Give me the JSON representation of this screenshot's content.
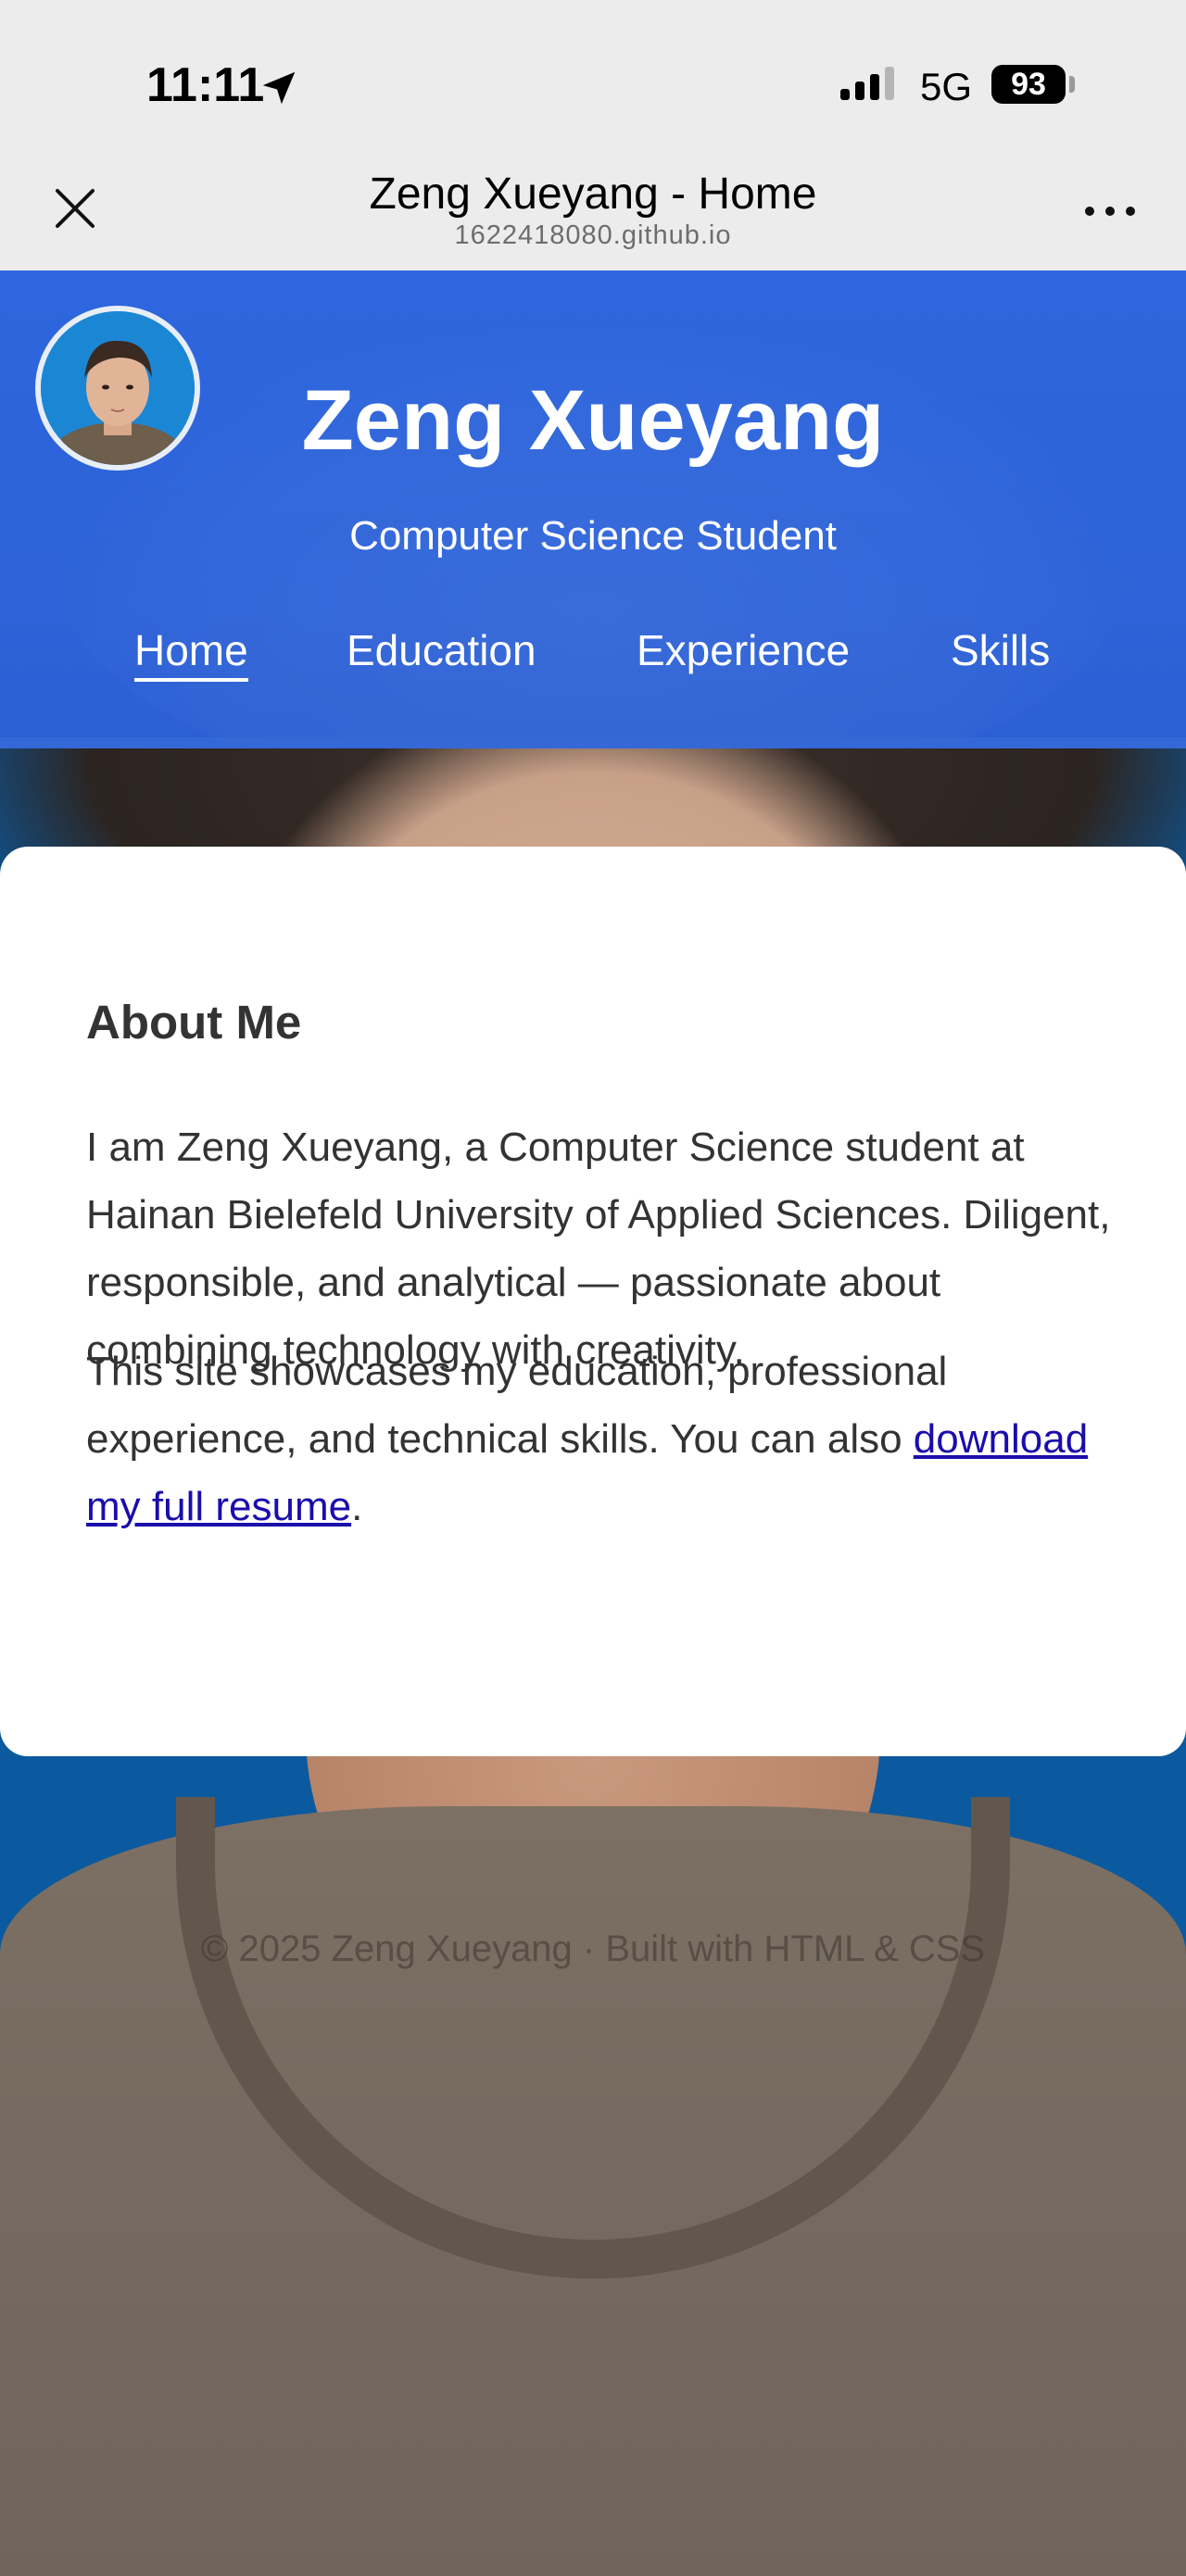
{
  "status_bar": {
    "time": "11:11",
    "network": "5G",
    "battery": "93"
  },
  "browser": {
    "title": "Zeng Xueyang - Home",
    "url": "1622418080.github.io"
  },
  "site": {
    "name": "Zeng Xueyang",
    "subtitle": "Computer Science Student",
    "nav": [
      {
        "label": "Home",
        "active": true
      },
      {
        "label": "Education",
        "active": false
      },
      {
        "label": "Experience",
        "active": false
      },
      {
        "label": "Skills",
        "active": false
      }
    ]
  },
  "about": {
    "heading": "About Me",
    "paragraph1": "I am Zeng Xueyang, a Computer Science student at Hainan Bielefeld University of Applied Sciences. Diligent, responsible, and analytical — passionate about combining technology with creativity.",
    "paragraph2_prefix": "This site showcases my education, professional experience, and technical skills. You can also ",
    "resume_link": "download my full resume",
    "paragraph2_suffix": "."
  },
  "footer": {
    "text": "© 2025 Zeng Xueyang · Built with HTML & CSS"
  },
  "colors": {
    "header_blue": "#2d66de",
    "link": "#1a0dab",
    "card_bg": "#ffffff"
  }
}
